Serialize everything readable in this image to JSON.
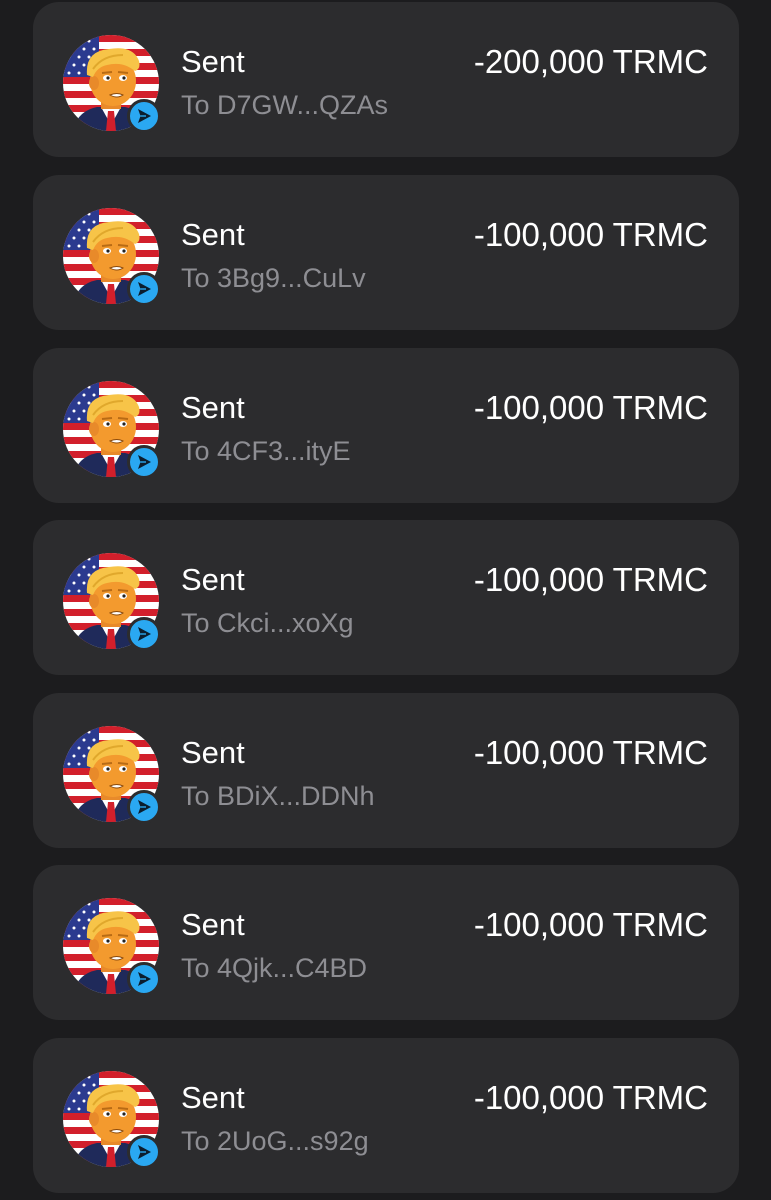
{
  "colors": {
    "background": "#1c1c1e",
    "card": "#2c2c2e",
    "primary_text": "#ffffff",
    "secondary_text": "#8e8e93",
    "badge": "#2aa8f2"
  },
  "icons": {
    "avatar": "trump-cartoon-avatar-icon",
    "badge": "send-arrow-icon"
  },
  "transactions": [
    {
      "title": "Sent",
      "recipient": "To D7GW...QZAs",
      "amount": "-200,000 TRMC"
    },
    {
      "title": "Sent",
      "recipient": "To 3Bg9...CuLv",
      "amount": "-100,000 TRMC"
    },
    {
      "title": "Sent",
      "recipient": "To 4CF3...ityE",
      "amount": "-100,000 TRMC"
    },
    {
      "title": "Sent",
      "recipient": "To Ckci...xoXg",
      "amount": "-100,000 TRMC"
    },
    {
      "title": "Sent",
      "recipient": "To BDiX...DDNh",
      "amount": "-100,000 TRMC"
    },
    {
      "title": "Sent",
      "recipient": "To 4Qjk...C4BD",
      "amount": "-100,000 TRMC"
    },
    {
      "title": "Sent",
      "recipient": "To 2UoG...s92g",
      "amount": "-100,000 TRMC"
    }
  ]
}
